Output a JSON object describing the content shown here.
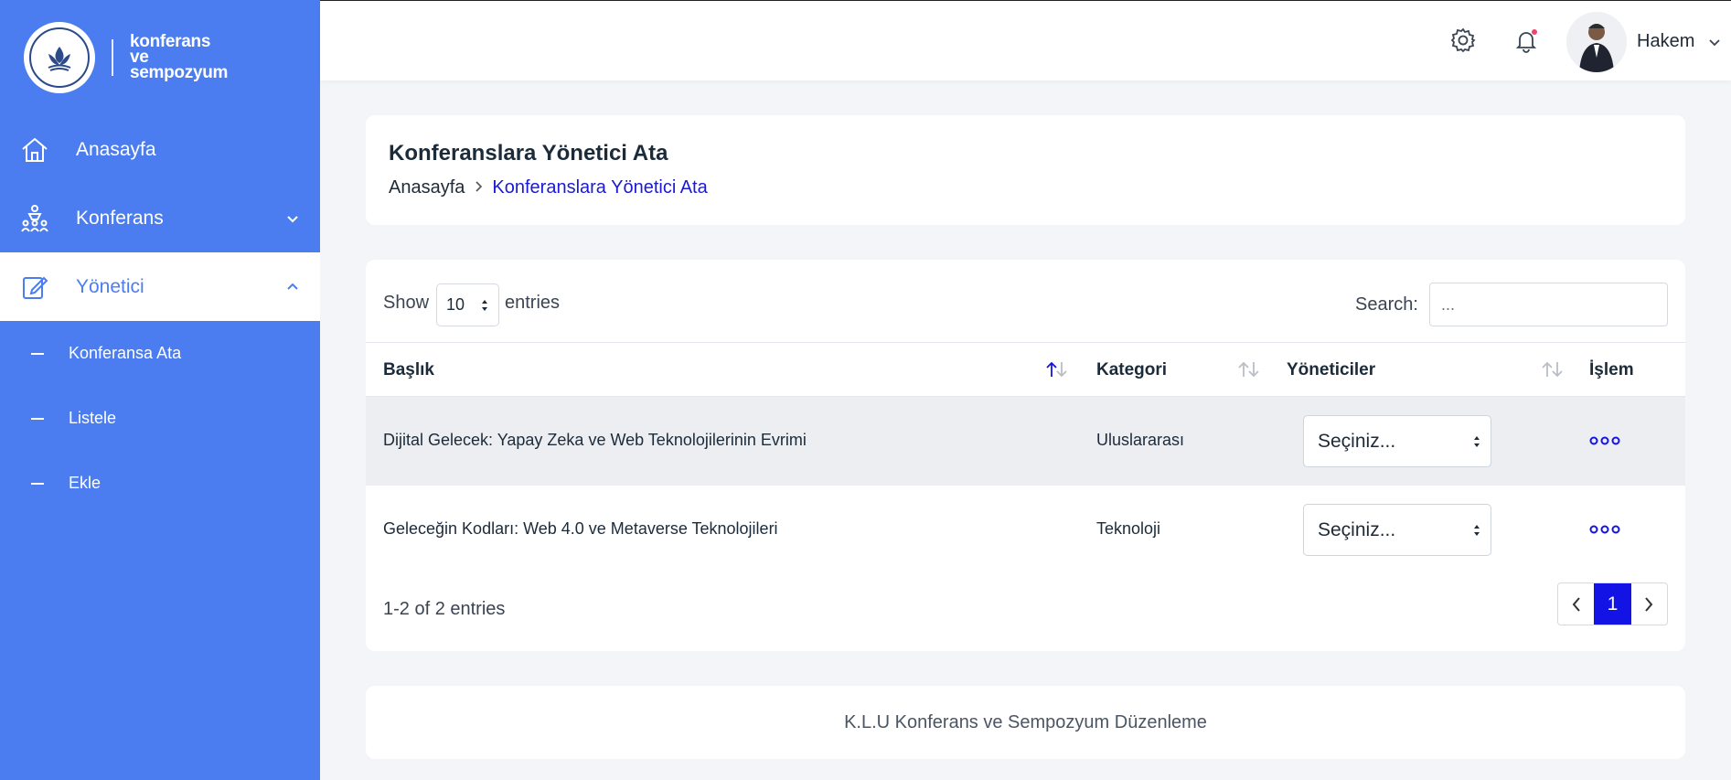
{
  "brand": {
    "logo_text": "konferans ve sempozyum",
    "logo_seal": "KIRKLARELİ ÜNİVERSİTESİ 2007"
  },
  "sidebar": {
    "items": [
      {
        "label": "Anasayfa",
        "icon": "home-icon"
      },
      {
        "label": "Konferans",
        "icon": "conference-icon",
        "expanded": false
      },
      {
        "label": "Yönetici",
        "icon": "edit-icon",
        "expanded": true
      }
    ],
    "sub_items": [
      {
        "label": "Konferansa Ata"
      },
      {
        "label": "Listele"
      },
      {
        "label": "Ekle"
      }
    ]
  },
  "topbar": {
    "user_name": "Hakem",
    "notification_dot_color": "#f0456b"
  },
  "page": {
    "title": "Konferanslara Yönetici Ata",
    "breadcrumb": {
      "home": "Anasayfa",
      "current": "Konferanslara Yönetici Ata"
    }
  },
  "table": {
    "show_label": "Show",
    "entries_value": "10",
    "entries_label": "entries",
    "search_label": "Search:",
    "search_placeholder": "...",
    "columns": [
      "Başlık",
      "Kategori",
      "Yöneticiler",
      "İşlem"
    ],
    "sorted_column": "Başlık",
    "rows": [
      {
        "title": "Dijital Gelecek: Yapay Zeka ve Web Teknolojilerinin Evrimi",
        "category": "Uluslararası",
        "manager": "Seçiniz..."
      },
      {
        "title": "Geleceğin Kodları: Web 4.0 ve Metaverse Teknolojileri",
        "category": "Teknoloji",
        "manager": "Seçiniz..."
      }
    ],
    "info": "1-2 of 2 entries",
    "current_page": "1"
  },
  "footer": {
    "text": "K.L.U Konferans ve Sempozyum Düzenleme"
  },
  "colors": {
    "sidebar": "#4c7df0",
    "accent": "#1313e6",
    "background": "#f4f5f9"
  }
}
